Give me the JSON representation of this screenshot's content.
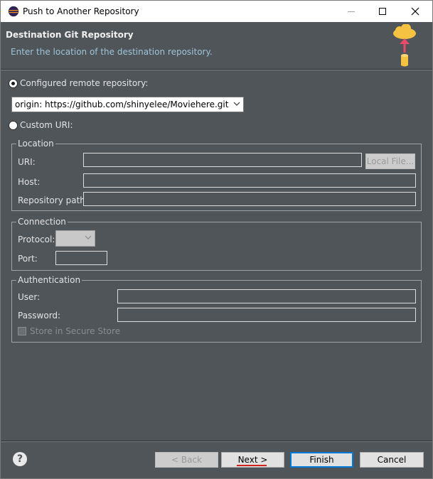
{
  "window": {
    "title": "Push to Another Repository"
  },
  "header": {
    "title": "Destination Git Repository",
    "description": "Enter the location of the destination repository."
  },
  "remote": {
    "configured_label": "Configured remote repository:",
    "configured_selected": true,
    "selected_remote": "origin: https://github.com/shinyelee/Moviehere.git",
    "custom_label": "Custom URI:",
    "custom_selected": false
  },
  "location": {
    "group_label": "Location",
    "uri_label": "URI:",
    "uri_value": "",
    "local_file_button": "Local File...",
    "host_label": "Host:",
    "host_value": "",
    "path_label": "Repository path:",
    "path_value": ""
  },
  "connection": {
    "group_label": "Connection",
    "protocol_label": "Protocol:",
    "protocol_value": "",
    "port_label": "Port:",
    "port_value": ""
  },
  "authentication": {
    "group_label": "Authentication",
    "user_label": "User:",
    "user_value": "",
    "password_label": "Password:",
    "password_value": "",
    "secure_store_label": "Store in Secure Store",
    "secure_store_checked": false
  },
  "footer": {
    "help_symbol": "?",
    "back": "< Back",
    "next": "Next >",
    "finish": "Finish",
    "cancel": "Cancel"
  },
  "colors": {
    "background": "#50555a",
    "header_description": "#9ec4d8",
    "default_button_border": "#0078d7",
    "annotation_underline": "#d02020"
  },
  "icons": [
    "eclipse-icon",
    "minimize-icon",
    "maximize-icon",
    "close-icon",
    "cloud-upload-icon",
    "dropdown-arrow-icon",
    "help-icon"
  ]
}
